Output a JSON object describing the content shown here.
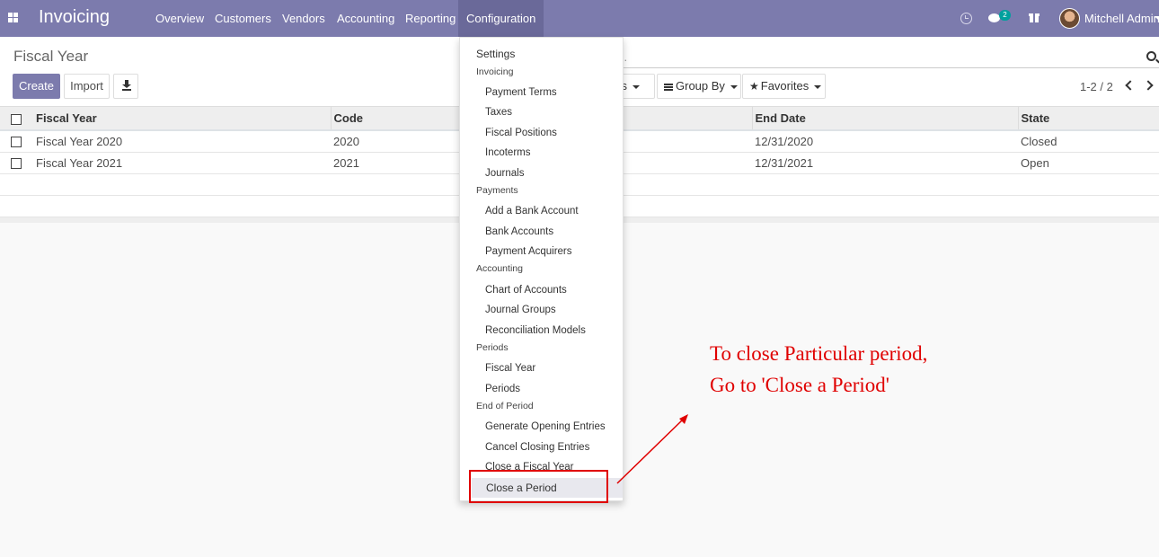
{
  "navbar": {
    "brand": "Invoicing",
    "menu": [
      "Overview",
      "Customers",
      "Vendors",
      "Accounting",
      "Reporting",
      "Configuration"
    ],
    "active_menu": "Configuration",
    "messages_badge": "2",
    "user_name": "Mitchell Admin"
  },
  "control_panel": {
    "title": "Fiscal Year",
    "create_label": "Create",
    "import_label": "Import",
    "search_placeholder": "n...",
    "filters_label": "ers",
    "groupby_label": "Group By",
    "favorites_label": "Favorites",
    "pager": "1-2 / 2"
  },
  "table": {
    "columns": [
      "Fiscal Year",
      "Code",
      "End Date",
      "State"
    ],
    "rows": [
      {
        "fiscal_year": "Fiscal Year 2020",
        "code": "2020",
        "end_date": "12/31/2020",
        "state": "Closed"
      },
      {
        "fiscal_year": "Fiscal Year 2021",
        "code": "2021",
        "end_date": "12/31/2021",
        "state": "Open"
      }
    ]
  },
  "dropdown": {
    "settings": "Settings",
    "sections": [
      {
        "header": "Invoicing",
        "items": [
          "Payment Terms",
          "Taxes",
          "Fiscal Positions",
          "Incoterms",
          "Journals"
        ]
      },
      {
        "header": "Payments",
        "items": [
          "Add a Bank Account",
          "Bank Accounts",
          "Payment Acquirers"
        ]
      },
      {
        "header": "Accounting",
        "items": [
          "Chart of Accounts",
          "Journal Groups",
          "Reconciliation Models"
        ]
      },
      {
        "header": "Periods",
        "items": [
          "Fiscal Year",
          "Periods"
        ]
      },
      {
        "header": "End of Period",
        "items": [
          "Generate Opening Entries",
          "Cancel Closing Entries",
          "Close a Fiscal Year",
          "Close a Period"
        ]
      }
    ]
  },
  "annotation": {
    "line1": "To close Particular period,",
    "line2": "Go to 'Close a Period'",
    "color": "#e00000"
  },
  "colors": {
    "brand": "#7c7bad",
    "badge": "#00a09d"
  }
}
